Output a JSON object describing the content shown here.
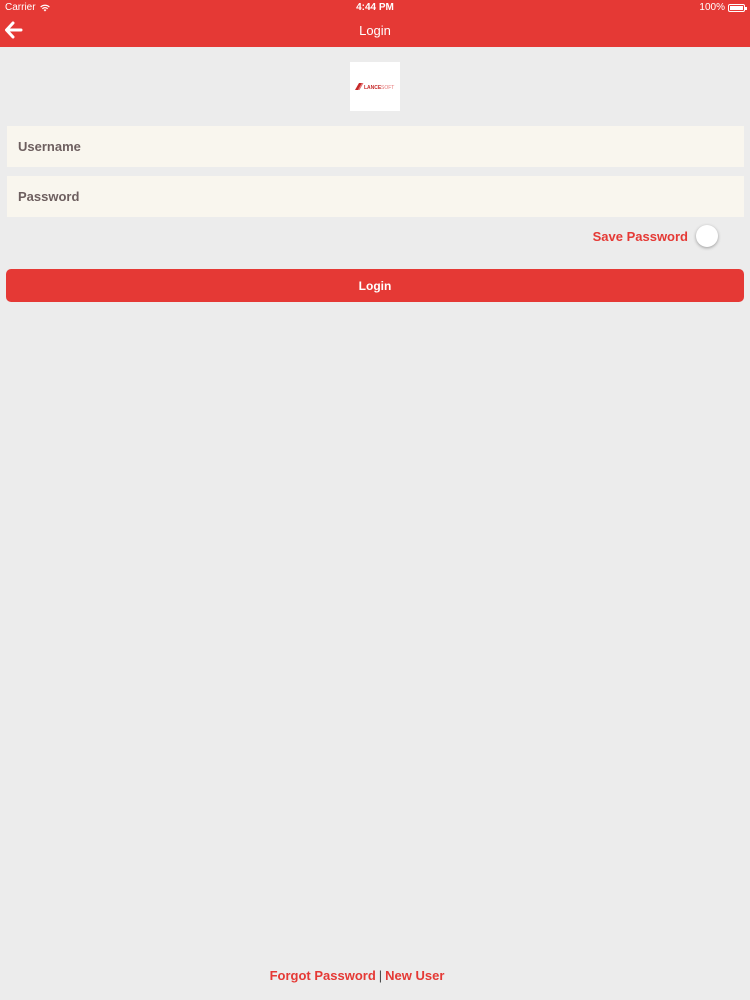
{
  "status_bar": {
    "carrier": "Carrier",
    "time": "4:44 PM",
    "battery": "100%"
  },
  "nav": {
    "title": "Login"
  },
  "logo": {
    "text_primary": "LANCE",
    "text_secondary": "SOFT"
  },
  "form": {
    "username_placeholder": "Username",
    "password_placeholder": "Password",
    "save_password_label": "Save Password",
    "save_password_on": false,
    "login_label": "Login"
  },
  "footer": {
    "forgot_label": "Forgot Password",
    "separator": "|",
    "new_user_label": "New User"
  },
  "colors": {
    "accent": "#e53935",
    "background": "#ececec",
    "field_bg": "#f9f6ee"
  }
}
